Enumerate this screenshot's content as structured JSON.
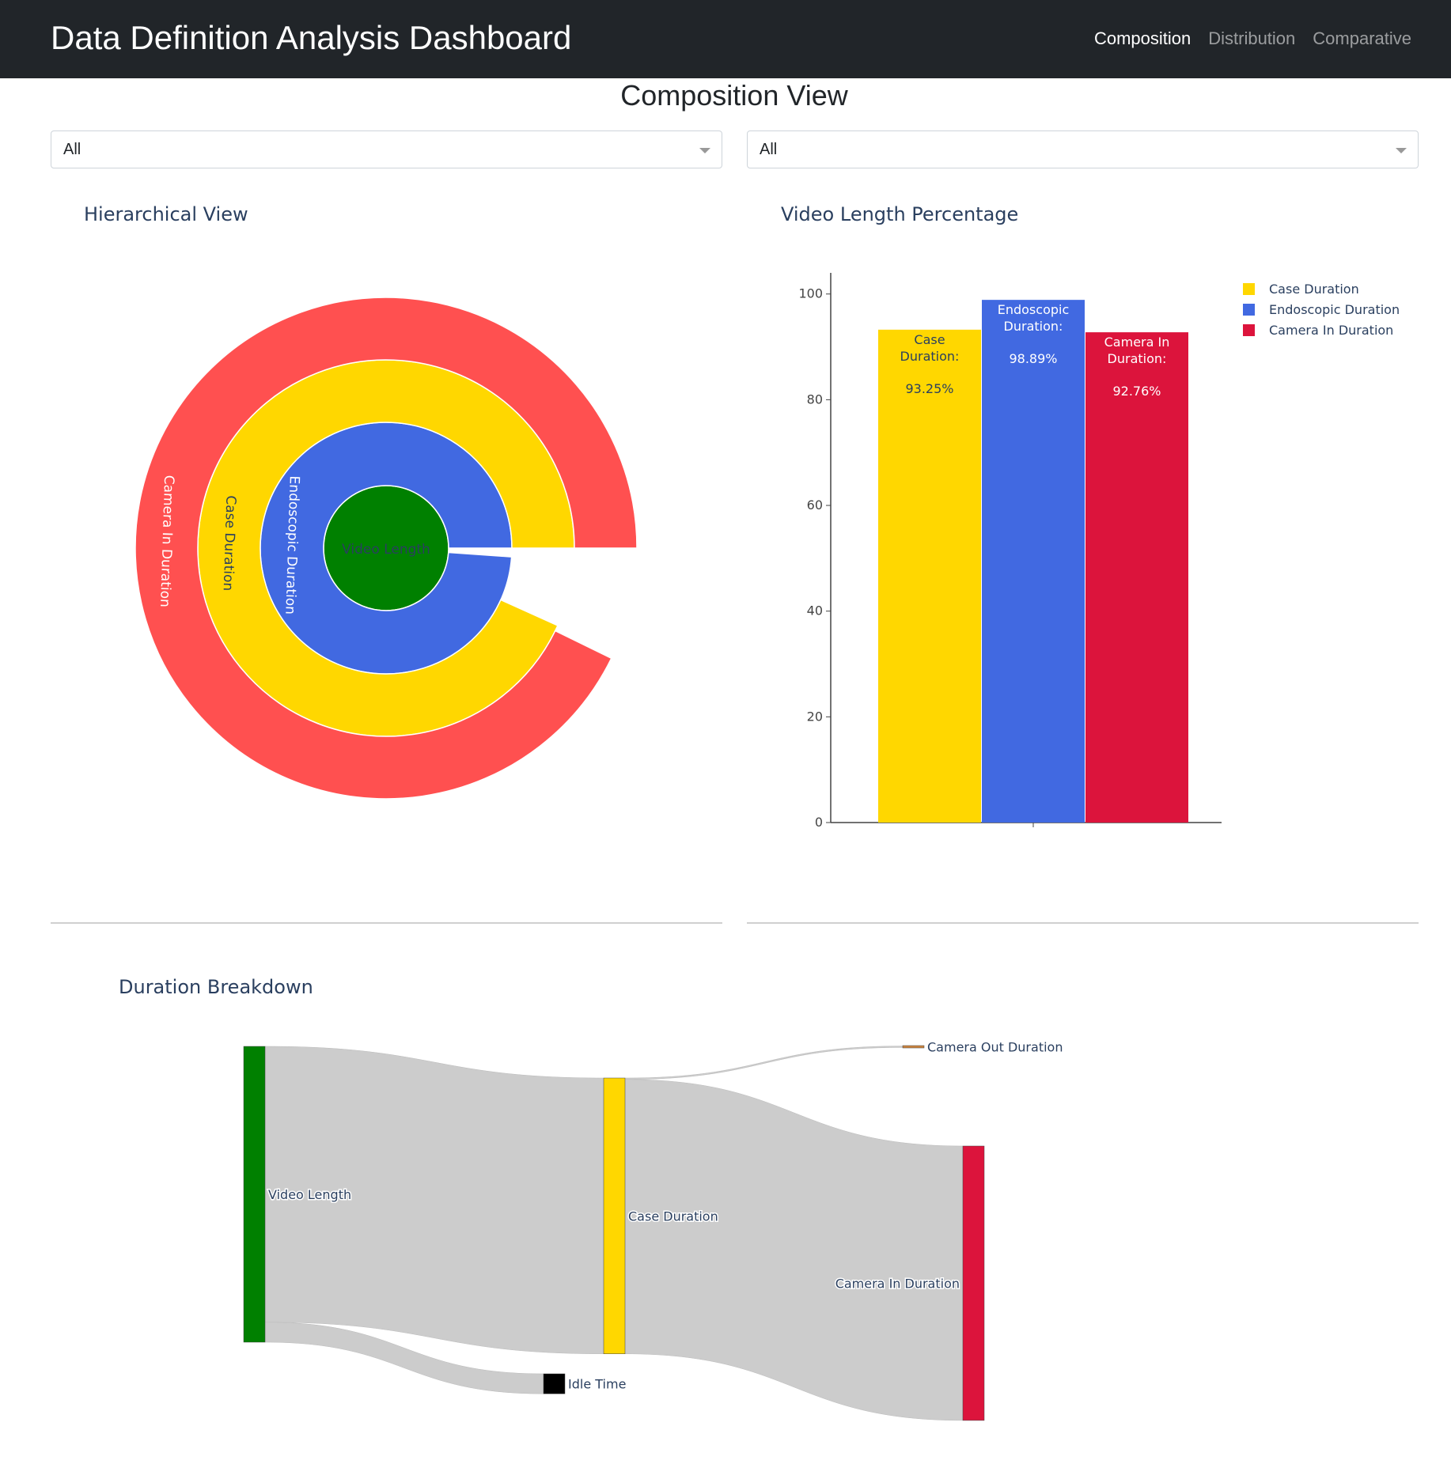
{
  "app": {
    "title": "Data Definition Analysis Dashboard",
    "nav": [
      {
        "label": "Composition",
        "active": true
      },
      {
        "label": "Distribution",
        "active": false
      },
      {
        "label": "Comparative",
        "active": false
      }
    ]
  },
  "page": {
    "title": "Composition View",
    "filter_left": {
      "value": "All"
    },
    "filter_right": {
      "value": "All"
    }
  },
  "colors": {
    "video_length": "#008000",
    "endoscopic": "#4169e1",
    "case": "#ffd700",
    "camera_in_sunburst": "#ff5050",
    "camera_in": "#dc143c",
    "camera_out": "#cd853f",
    "idle": "#000000",
    "link": "#cccccc"
  },
  "sunburst": {
    "title": "Hierarchical View",
    "center_label": "Video Length",
    "rings": [
      {
        "label": "Endoscopic Duration",
        "color": "#4169e1",
        "fraction": 0.9889
      },
      {
        "label": "Case Duration",
        "color": "#ffd700",
        "fraction": 0.9325
      },
      {
        "label": "Camera In Duration",
        "color": "#ff5050",
        "fraction": 0.9276
      }
    ]
  },
  "chart_data": [
    {
      "type": "bar",
      "title": "Video Length Percentage",
      "categories": [
        ""
      ],
      "series": [
        {
          "name": "Case Duration",
          "values": [
            93.25
          ],
          "color": "#ffd700",
          "text": [
            "Case",
            "Duration:",
            "93.25%"
          ]
        },
        {
          "name": "Endoscopic Duration",
          "values": [
            98.89
          ],
          "color": "#4169e1",
          "text": [
            "Endoscopic",
            "Duration:",
            "98.89%"
          ]
        },
        {
          "name": "Camera In Duration",
          "values": [
            92.76
          ],
          "color": "#dc143c",
          "text": [
            "Camera In",
            "Duration:",
            "92.76%"
          ]
        }
      ],
      "ylim": [
        0,
        104
      ],
      "yticks": [
        0,
        20,
        40,
        60,
        80,
        100
      ],
      "legend": "top-right"
    }
  ],
  "sankey": {
    "title": "Duration Breakdown",
    "nodes": [
      "Video Length",
      "Case Duration",
      "Idle Time",
      "Camera Out Duration",
      "Camera In Duration"
    ],
    "links": [
      {
        "source": "Video Length",
        "target": "Case Duration",
        "value": 93.25
      },
      {
        "source": "Video Length",
        "target": "Idle Time",
        "value": 6.75
      },
      {
        "source": "Case Duration",
        "target": "Camera Out Duration",
        "value": 0.49
      },
      {
        "source": "Case Duration",
        "target": "Camera In Duration",
        "value": 92.76
      }
    ]
  }
}
